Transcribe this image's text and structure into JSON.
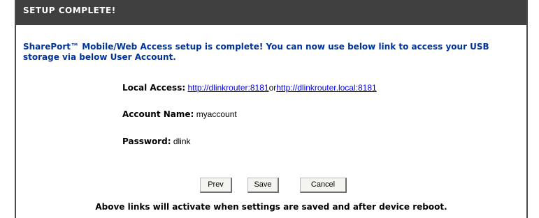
{
  "header": {
    "title": "SETUP COMPLETE!"
  },
  "intro": "SharePort™ Mobile/Web Access setup is complete! You can now use below link to access your USB storage via below User Account.",
  "local_access": {
    "label": "Local Access:",
    "link1": "http://dlinkrouter:8181",
    "separator": "or",
    "link2": "http://dlinkrouter.local:8181"
  },
  "account": {
    "label": "Account Name:",
    "value": "myaccount"
  },
  "password": {
    "label": "Password:",
    "value": "dlink"
  },
  "buttons": {
    "prev": "Prev",
    "save": "Save",
    "cancel": "Cancel"
  },
  "note": "Above links will activate when settings are saved and after device reboot.",
  "colors": {
    "header_bg": "#404040",
    "intro_text": "#003399",
    "link": "#0000ee"
  }
}
